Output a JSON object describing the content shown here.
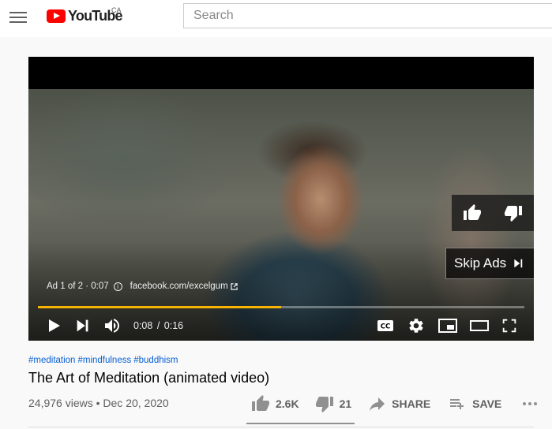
{
  "header": {
    "logo_text": "YouTube",
    "region": "CA",
    "search_placeholder": "Search"
  },
  "player": {
    "ad_label": "Ad 1 of 2 · 0:07",
    "ad_link": "facebook.com/excelgum",
    "skip_label": "Skip Ads",
    "time_current": "0:08",
    "time_separator": "/",
    "time_total": "0:16",
    "progress_fraction": 0.5
  },
  "video": {
    "tags": [
      "#meditation",
      "#mindfulness",
      "#buddhism"
    ],
    "title": "The Art of Meditation (animated video)",
    "views": "24,976 views",
    "date_separator": "•",
    "date": "Dec 20, 2020",
    "likes": "2.6K",
    "dislikes": "21",
    "share_label": "SHARE",
    "save_label": "SAVE"
  },
  "colors": {
    "brand_red": "#ff0000",
    "progress": "#f6b400",
    "link_blue": "#065fd4"
  }
}
